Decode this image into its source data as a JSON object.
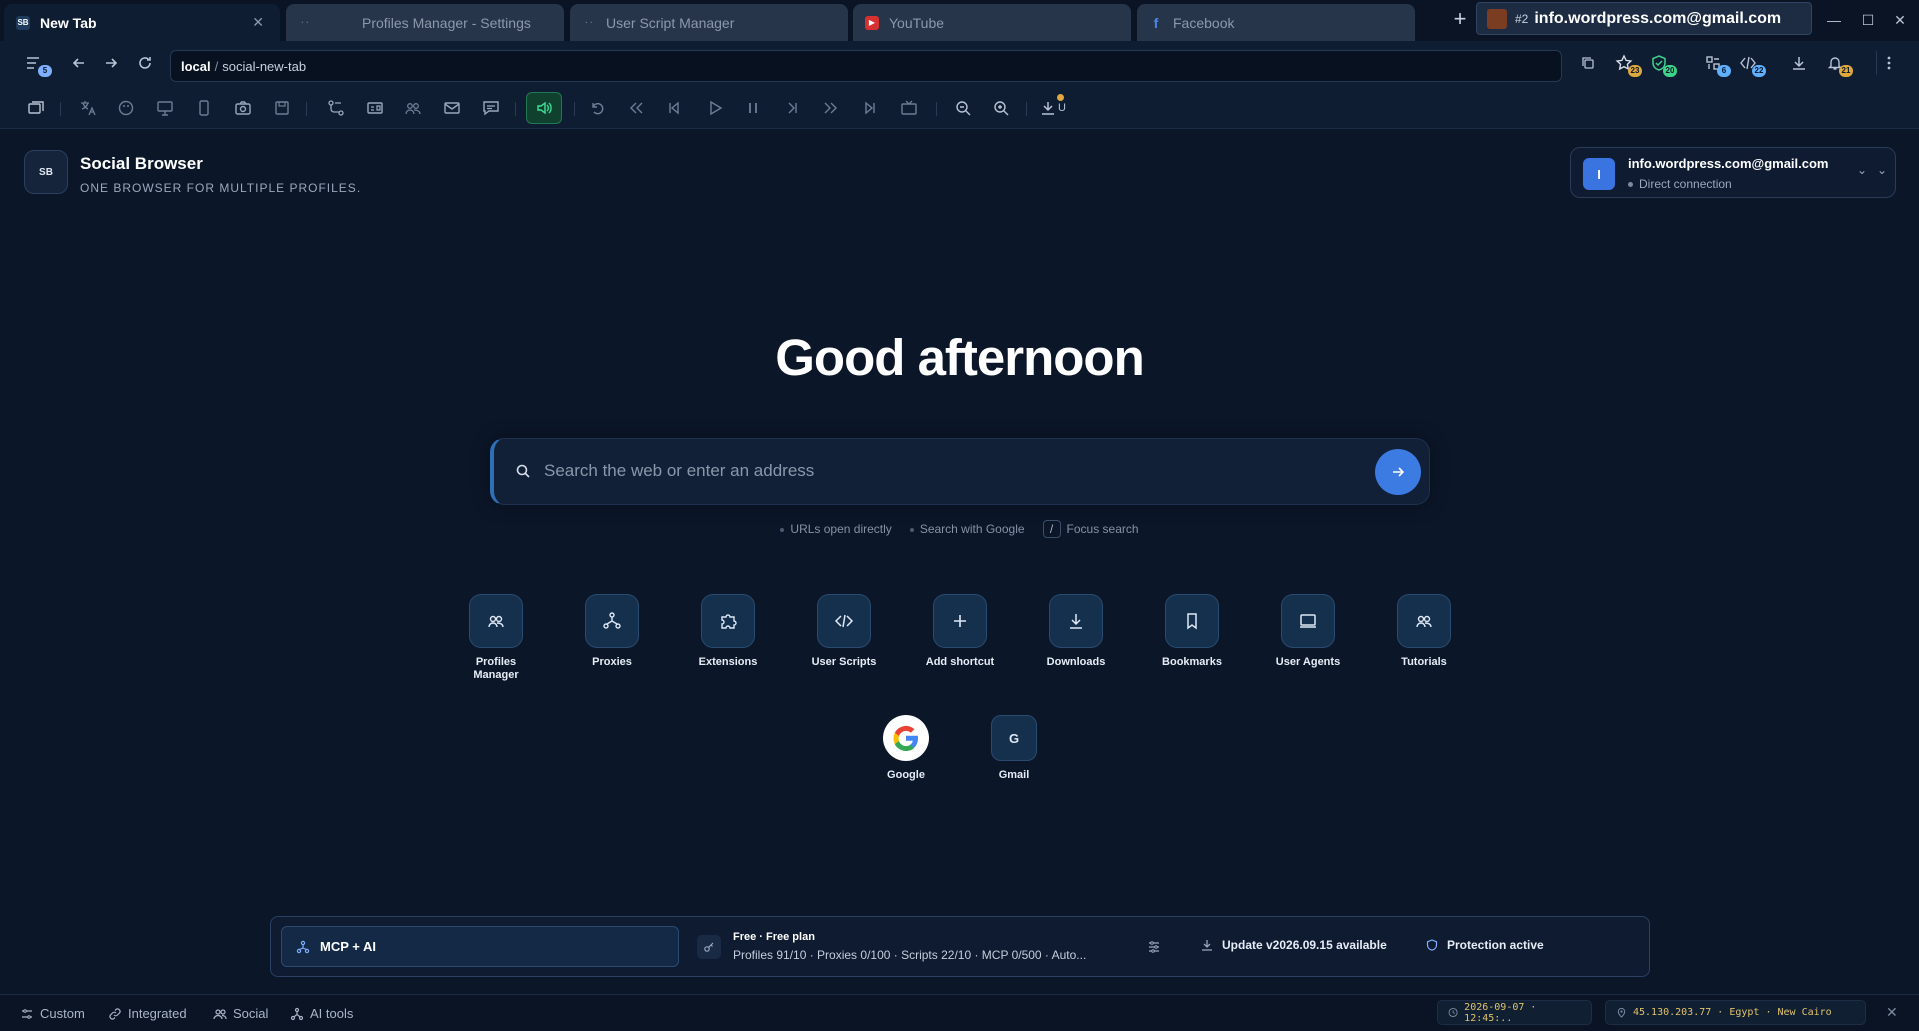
{
  "tabs": [
    {
      "title": "New Tab",
      "favicon": "SB",
      "active": true
    },
    {
      "title": "Profiles Manager - Settings",
      "active": false
    },
    {
      "title": "User Script Manager",
      "active": false
    },
    {
      "title": "YouTube",
      "active": false
    },
    {
      "title": "Facebook",
      "active": false
    }
  ],
  "titlebar": {
    "profile_number": "#2",
    "profile_email": "info.wordpress.com@gmail.com"
  },
  "addressbar": {
    "scheme": "local",
    "separator": "/",
    "path": "social-new-tab",
    "menu_badge": "5"
  },
  "toolbar_badges": {
    "favorites": "23",
    "shield": "20",
    "extensions": "6",
    "scripts": "22",
    "notifications": "21"
  },
  "toolbar_download_label": "U",
  "brand": {
    "logo_text": "SB",
    "title": "Social Browser",
    "subtitle": "ONE BROWSER FOR MULTIPLE PROFILES."
  },
  "account": {
    "avatar_letter": "I",
    "email": "info.wordpress.com@gmail.com",
    "status": "Direct connection"
  },
  "greeting": "Good afternoon",
  "search": {
    "placeholder": "Search the web or enter an address",
    "hint_urls": "URLs open directly",
    "hint_google": "Search with Google",
    "hint_key": "/",
    "hint_focus": "Focus search"
  },
  "shortcuts": [
    {
      "label": "Profiles Manager",
      "icon": "users-icon"
    },
    {
      "label": "Proxies",
      "icon": "network-icon"
    },
    {
      "label": "Extensions",
      "icon": "puzzle-icon"
    },
    {
      "label": "User Scripts",
      "icon": "code-icon"
    },
    {
      "label": "Add shortcut",
      "icon": "plus-icon"
    },
    {
      "label": "Downloads",
      "icon": "download-icon"
    },
    {
      "label": "Bookmarks",
      "icon": "bookmark-icon"
    },
    {
      "label": "User Agents",
      "icon": "monitor-icon"
    },
    {
      "label": "Tutorials",
      "icon": "users-icon"
    }
  ],
  "sites": [
    {
      "label": "Google",
      "icon": "google-icon"
    },
    {
      "label": "Gmail",
      "letter": "G"
    }
  ],
  "info_panel": {
    "mcp_label": "MCP + AI",
    "plan_title": "Free · Free plan",
    "plan_stats": "Profiles 91/10 · Proxies 0/100 · Scripts 22/10 · MCP 0/500 · Auto...",
    "update": "Update v2026.09.15 available",
    "protection": "Protection active"
  },
  "statusbar": {
    "custom": "Custom",
    "integrated": "Integrated",
    "social": "Social",
    "ai_tools": "AI tools",
    "datetime": "2026-09-07 · 12:45:..",
    "location": "45.130.203.77 · Egypt · New Cairo"
  },
  "colors": {
    "background": "#0b1628",
    "accent": "#3b7be2",
    "sound_active": "#3fe29a"
  }
}
